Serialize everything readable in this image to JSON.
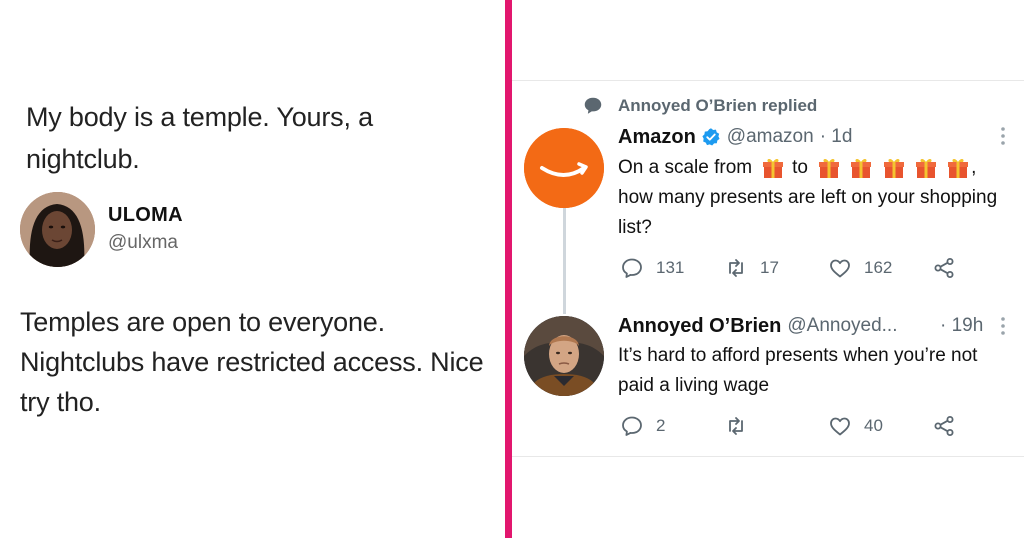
{
  "left": {
    "quote": "My body is a temple. Yours, a nightclub.",
    "name": "ULOMA",
    "handle": "@ulxma",
    "reply": "Temples are open to everyone. Nightclubs have restricted access. Nice try tho."
  },
  "right": {
    "replied_label": "Annoyed O’Brien replied",
    "tweet1": {
      "name": "Amazon",
      "handle": "@amazon",
      "time": "· 1d",
      "text_start": "On a scale from",
      "text_to": "to",
      "text_comma": ",",
      "text_rest": "how many presents are left on your shopping list?",
      "gift_emoji": "wrapped-gift-icon",
      "replies": "131",
      "retweets": "17",
      "likes": "162"
    },
    "tweet2": {
      "name": "Annoyed O’Brien",
      "handle": "@Annoyed...",
      "time": "· 19h",
      "text": "It’s hard to afford presents when you’re not paid a living wage",
      "replies": "2",
      "retweets": "",
      "likes": "40"
    }
  },
  "colors": {
    "divider": "#e2166e",
    "amazon_orange": "#f36a15",
    "verified_blue": "#1d9bf0",
    "secondary_text": "#5b6770"
  }
}
